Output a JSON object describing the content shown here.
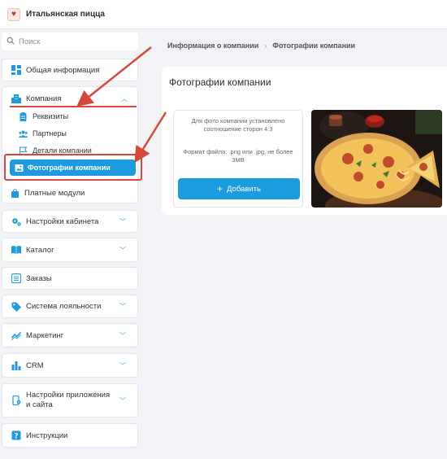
{
  "app": {
    "name": "Итальянская пицца"
  },
  "search": {
    "placeholder": "Поиск"
  },
  "sidebar": {
    "general": "Общая информация",
    "company": {
      "label": "Компания",
      "children": [
        "Реквизиты",
        "Партнеры",
        "Детали компании",
        "Фотографии компании"
      ]
    },
    "paid_modules": "Платные модули",
    "cabinet_settings": "Настройки кабинета",
    "catalog": "Каталог",
    "orders": "Заказы",
    "loyalty": "Система лояльности",
    "marketing": "Маркетинг",
    "crm": "CRM",
    "app_settings_line1": "Настройки приложения",
    "app_settings_line2": "и сайта",
    "instructions": "Инструкции"
  },
  "breadcrumb": {
    "parent": "Информация о компании",
    "separator": "›",
    "current": "Фотографии компании"
  },
  "panel": {
    "title": "Фотографии компании",
    "upload": {
      "ratio_line1": "Для фото компании установлено",
      "ratio_line2": "соотношение сторон 4:3",
      "format_line1": "Формат файла: .png или .jpg, не более",
      "format_line2": "3MB",
      "add_label": "Добавить"
    }
  },
  "colors": {
    "accent": "#1d9be0",
    "annotation": "#d8473a"
  }
}
